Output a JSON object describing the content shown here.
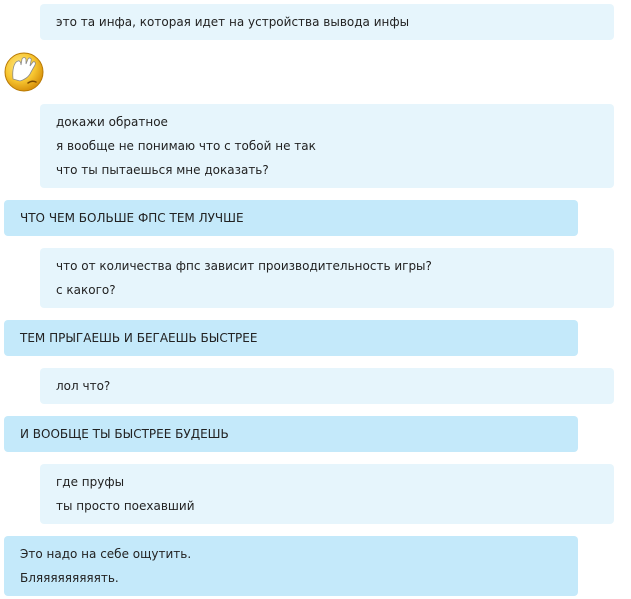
{
  "messages": [
    {
      "side": "outgoing",
      "lines": [
        "это та инфа, которая идет на устройства вывода инфы"
      ]
    },
    {
      "side": "incoming",
      "emoticon": "facepalm-emoticon"
    },
    {
      "side": "outgoing",
      "lines": [
        "докажи обратное",
        "я вообще не понимаю что с тобой не так",
        "что ты пытаешься мне доказать?"
      ]
    },
    {
      "side": "incoming",
      "lines": [
        "ЧТО ЧЕМ БОЛЬШЕ ФПС ТЕМ ЛУЧШЕ"
      ]
    },
    {
      "side": "outgoing",
      "lines": [
        "что от количества фпс зависит производительность игры?",
        "с какого?"
      ]
    },
    {
      "side": "incoming",
      "lines": [
        "ТЕМ ПРЫГАЕШЬ И БЕГАЕШЬ БЫСТРЕЕ"
      ]
    },
    {
      "side": "outgoing",
      "lines": [
        "лол что?"
      ]
    },
    {
      "side": "incoming",
      "lines": [
        "И ВООБЩЕ ТЫ БЫСТРЕЕ БУДЕШЬ"
      ]
    },
    {
      "side": "outgoing",
      "lines": [
        "где пруфы",
        "ты просто поехавший"
      ]
    },
    {
      "side": "incoming",
      "lines": [
        "Это надо на себе ощутить.",
        "Бляяяяяяяяять."
      ]
    }
  ],
  "colors": {
    "outgoing_bubble": "#e6f5fc",
    "incoming_bubble": "#c4e9fa",
    "text": "#222222"
  }
}
